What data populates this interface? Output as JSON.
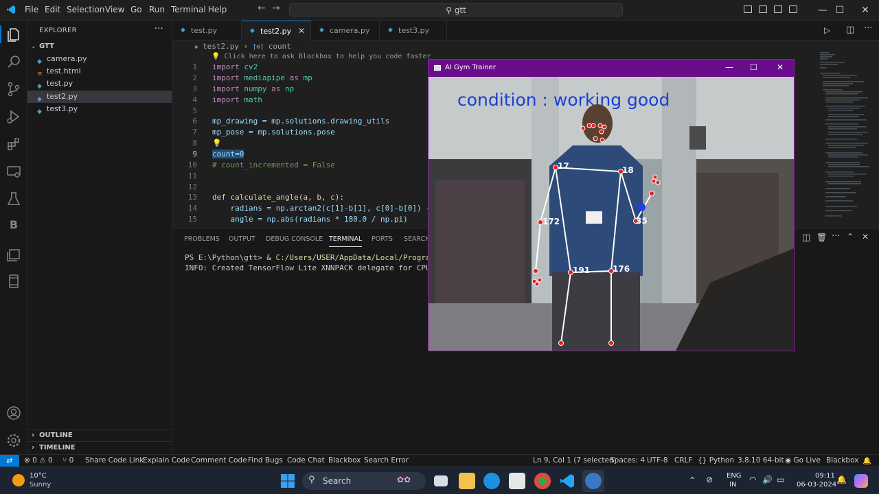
{
  "titlebar": {
    "menu": [
      "File",
      "Edit",
      "Selection",
      "View",
      "Go",
      "Run",
      "Terminal",
      "Help"
    ],
    "search": "gtt"
  },
  "explorer": {
    "header": "EXPLORER",
    "folder": "GTT",
    "files": [
      "camera.py",
      "test.html",
      "test.py",
      "test2.py",
      "test3.py"
    ],
    "selected": "test2.py",
    "outline": "OUTLINE",
    "timeline": "TIMELINE"
  },
  "tabs": [
    {
      "label": "test.py",
      "active": false
    },
    {
      "label": "test2.py",
      "active": true
    },
    {
      "label": "camera.py",
      "active": false
    },
    {
      "label": "test3.py",
      "active": false
    }
  ],
  "editor": {
    "breadcrumb_file": "test2.py",
    "breadcrumb_symbol": "count",
    "hint": "Click here to ask Blackbox to help you code faster",
    "line_numbers": [
      "1",
      "2",
      "3",
      "4",
      "5",
      "6",
      "7",
      "8",
      "9",
      "10",
      "11",
      "12",
      "13",
      "14",
      "15"
    ],
    "current_line": 9,
    "lines": [
      "import cv2",
      "import mediapipe as mp",
      "import numpy as np",
      "import math",
      "",
      "mp_drawing = mp.solutions.drawing_utils",
      "mp_pose = mp.solutions.pose",
      "",
      "count=0",
      "# count_incremented = False",
      "",
      "",
      "def calculate_angle(a, b, c):",
      "    radians = np.arctan2(c[1]-b[1], c[0]-b[0]) -",
      "    angle = np.abs(radians * 180.0 / np.pi)"
    ]
  },
  "panel": {
    "tabs": [
      "PROBLEMS",
      "OUTPUT",
      "DEBUG CONSOLE",
      "TERMINAL",
      "PORTS",
      "SEARCH"
    ],
    "active_tab": "TERMINAL",
    "terminal_prompt": "PS E:\\Python\\gtt>",
    "terminal_cmd": "& C:/Users/USER/AppData/Local/Programs/Py",
    "terminal_line2": "INFO: Created TensorFlow Lite XNNPACK delegate for CPU."
  },
  "statusbar": {
    "errors": "0",
    "warnings": "0",
    "ports": "0",
    "left_items": [
      "Share Code Link",
      "Explain Code",
      "Comment Code",
      "Find Bugs",
      "Code Chat",
      "Blackbox",
      "Search Error"
    ],
    "position": "Ln 9, Col 1 (7 selected)",
    "spaces": "Spaces: 4",
    "encoding": "UTF-8",
    "eol": "CRLF",
    "language": "Python",
    "interpreter": "3.8.10 64-bit",
    "golive": "Go Live",
    "blackbox": "Blackbox"
  },
  "gym_window": {
    "title": "AI Gym Trainer",
    "overlay_text": "condition : working good",
    "angle_labels": [
      "17",
      "18",
      "172",
      "35",
      "191",
      "176"
    ]
  },
  "taskbar": {
    "weather_temp": "10°C",
    "weather_desc": "Sunny",
    "search_label": "Search",
    "lang_top": "ENG",
    "lang_bottom": "IN",
    "time": "09:11",
    "date": "06-03-2024"
  },
  "colors": {
    "accent": "#0078d4",
    "gym_titlebar": "#6a0d8a",
    "overlay_text": "#1a3fd8"
  }
}
